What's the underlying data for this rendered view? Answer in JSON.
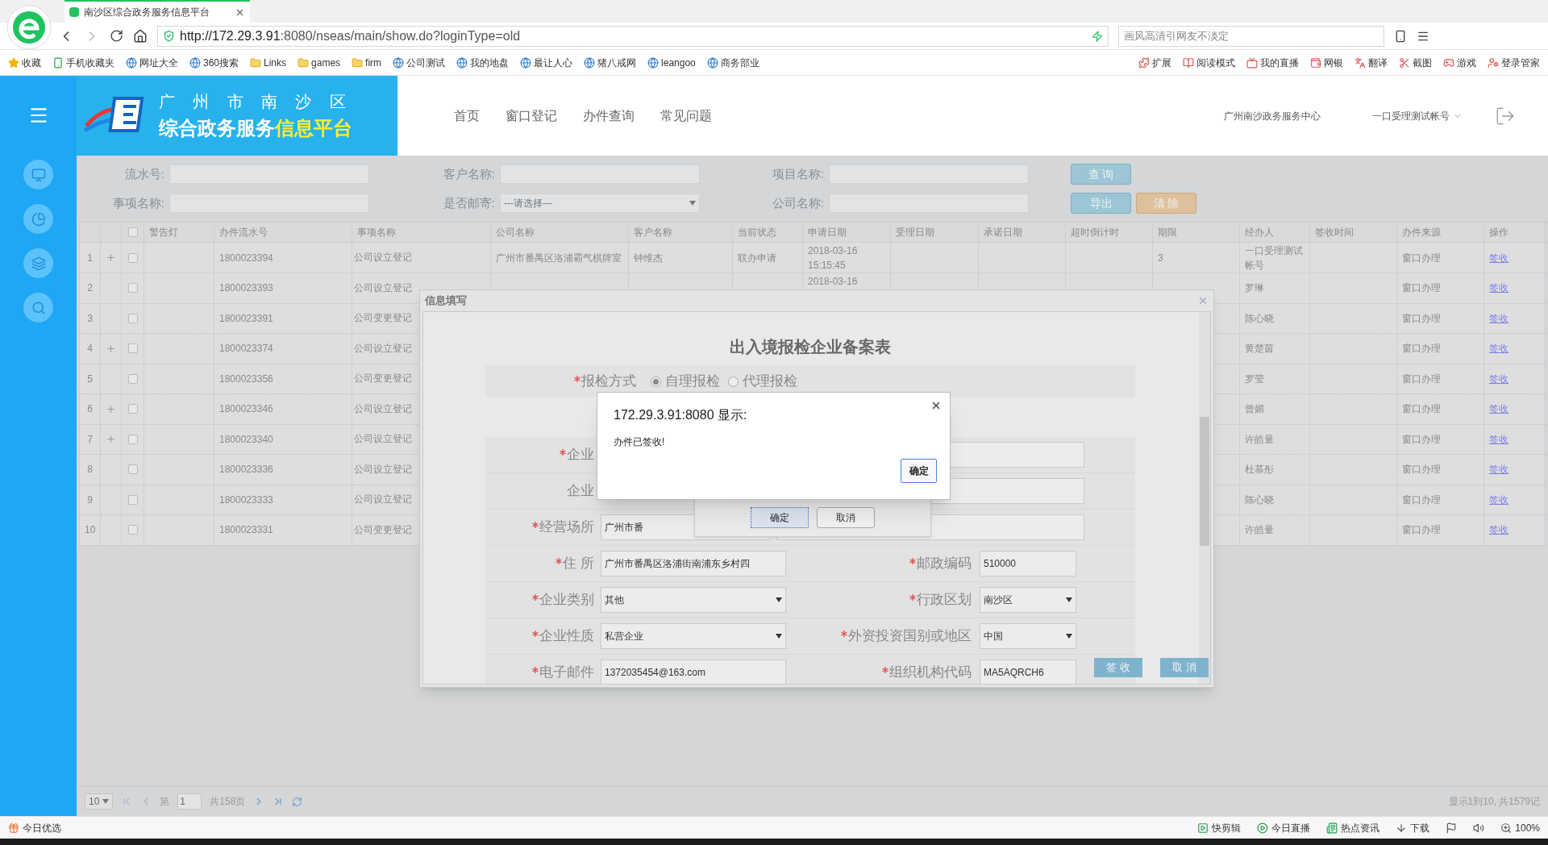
{
  "browser": {
    "tab_title": "南沙区综合政务服务信息平台",
    "url_host": "http://172.29.3.91",
    "url_rest": ":8080/nseas/main/show.do?loginType=old",
    "search_placeholder": "画风高清引网友不淡定",
    "bookmarks": [
      {
        "label": "收藏",
        "kind": "star"
      },
      {
        "label": "手机收藏夹",
        "kind": "phone"
      },
      {
        "label": "网址大全",
        "kind": "site"
      },
      {
        "label": "360搜索",
        "kind": "site"
      },
      {
        "label": "Links",
        "kind": "folder"
      },
      {
        "label": "games",
        "kind": "folder"
      },
      {
        "label": "firm",
        "kind": "folder"
      },
      {
        "label": "公司测试",
        "kind": "site"
      },
      {
        "label": "我的地盘",
        "kind": "site"
      },
      {
        "label": "最让人心",
        "kind": "site"
      },
      {
        "label": "猪八戒网",
        "kind": "site"
      },
      {
        "label": "leangoo",
        "kind": "site"
      },
      {
        "label": "商务部业",
        "kind": "site"
      }
    ],
    "tools": [
      "扩展",
      "阅读模式",
      "我的直播",
      "网银",
      "翻译",
      "截图",
      "游戏",
      "登录管家"
    ]
  },
  "header": {
    "logo_top": "广 州 市 南 沙 区",
    "logo_main": "综合政务服务",
    "logo_highlight": "信息平台",
    "nav": [
      "首页",
      "窗口登记",
      "办件查询",
      "常见问题"
    ],
    "center": "广州南沙政务服务中心",
    "account": "一口受理测试帐号"
  },
  "search": {
    "fields": [
      {
        "label": "流水号:",
        "kind": "input"
      },
      {
        "label": "客户名称:",
        "kind": "input"
      },
      {
        "label": "项目名称:",
        "kind": "input"
      },
      {
        "label": "事项名称:",
        "kind": "input"
      },
      {
        "label": "是否邮寄:",
        "kind": "select",
        "placeholder": "---请选择---"
      },
      {
        "label": "公司名称:",
        "kind": "input"
      }
    ],
    "buttons": [
      {
        "label": "查 询",
        "kind": "blue"
      },
      {
        "label": "导出",
        "kind": "blue"
      },
      {
        "label": "清 除",
        "kind": "orange"
      }
    ]
  },
  "table": {
    "header_checked": false,
    "columns": [
      "警告灯",
      "办件流水号",
      "事项名称",
      "公司名称",
      "客户名称",
      "当前状态",
      "申请日期",
      "受理日期",
      "承诺日期",
      "超时倒计时",
      "期限",
      "经办人",
      "签收时间",
      "办件来源",
      "操作"
    ],
    "rows": [
      {
        "no": "1",
        "expandable": true,
        "checked": false,
        "serial": "1800023394",
        "item": "公司设立登记",
        "company": "广州市番禺区洛浦霸气棋牌室",
        "customer": "钟维杰",
        "status": "联办申请",
        "apply_date": [
          "2018-03-16",
          "15:15:45"
        ],
        "period": "3",
        "handler": "一口受理测试帐号",
        "source": "窗口办理",
        "action": "签收"
      },
      {
        "no": "2",
        "expandable": false,
        "checked": false,
        "serial": "1800023393",
        "item": "公司设立登记",
        "apply_date": [
          "2018-03-16"
        ],
        "handler": "罗琳",
        "source": "窗口办理",
        "action": "签收"
      },
      {
        "no": "3",
        "expandable": false,
        "checked": false,
        "serial": "1800023391",
        "item": "公司变更登记",
        "handler": "陈心晓",
        "source": "窗口办理",
        "action": "签收"
      },
      {
        "no": "4",
        "expandable": true,
        "checked": false,
        "serial": "1800023374",
        "item": "公司设立登记",
        "handler": "黄楚茵",
        "source": "窗口办理",
        "action": "签收"
      },
      {
        "no": "5",
        "expandable": false,
        "checked": false,
        "serial": "1800023356",
        "item": "公司变更登记",
        "handler": "罗莹",
        "source": "窗口办理",
        "action": "签收"
      },
      {
        "no": "6",
        "expandable": true,
        "checked": false,
        "serial": "1800023346",
        "item": "公司设立登记",
        "handler": "曾媚",
        "source": "窗口办理",
        "action": "签收"
      },
      {
        "no": "7",
        "expandable": true,
        "checked": false,
        "serial": "1800023340",
        "item": "公司设立登记",
        "handler": "许皓量",
        "source": "窗口办理",
        "action": "签收"
      },
      {
        "no": "8",
        "expandable": false,
        "checked": false,
        "serial": "1800023336",
        "item": "公司设立登记",
        "handler": "杜慕彤",
        "source": "窗口办理",
        "action": "签收"
      },
      {
        "no": "9",
        "expandable": false,
        "checked": false,
        "serial": "1800023333",
        "item": "公司设立登记",
        "handler": "陈心晓",
        "source": "窗口办理",
        "action": "签收"
      },
      {
        "no": "10",
        "expandable": false,
        "checked": false,
        "serial": "1800023331",
        "item": "公司变更登记",
        "handler": "许皓量",
        "source": "窗口办理",
        "action": "签收"
      }
    ]
  },
  "pager": {
    "page_size": "10",
    "page_label": "第",
    "page": "1",
    "total_pages": "共158页",
    "summary": "显示1到10, 共1579记"
  },
  "dialog": {
    "title": "信息填写",
    "form_title": "出入境报检企业备案表",
    "radio_label": "报检方式",
    "radio_required": true,
    "radios": [
      {
        "label": "自理报检",
        "selected": true
      },
      {
        "label": "代理报检",
        "selected": false
      }
    ],
    "rows": [
      {
        "kind": "wide",
        "left": {
          "label": "企业",
          "required": true
        }
      },
      {
        "kind": "wide",
        "left": {
          "label": "企业",
          "required": false
        }
      },
      {
        "kind": "wide",
        "left": {
          "label": "经营场所",
          "required": true,
          "kind": "input",
          "value": "广州市番"
        }
      },
      {
        "kind": "pair",
        "left": {
          "label": "住 所",
          "required": true,
          "kind": "input",
          "value": "广州市番禺区洛浦街南浦东乡村四"
        },
        "right": {
          "label": "邮政编码",
          "required": true,
          "kind": "input",
          "value": "510000"
        }
      },
      {
        "kind": "pair",
        "left": {
          "label": "企业类别",
          "required": true,
          "kind": "select",
          "value": "其他"
        },
        "right": {
          "label": "行政区划",
          "required": true,
          "kind": "select",
          "value": "南沙区"
        }
      },
      {
        "kind": "pair",
        "left": {
          "label": "企业性质",
          "required": true,
          "kind": "select",
          "value": "私营企业"
        },
        "right": {
          "label": "外资投资国别或地区",
          "required": true,
          "kind": "select",
          "value": "中国"
        }
      },
      {
        "kind": "pair",
        "left": {
          "label": "电子邮件",
          "required": true,
          "kind": "input",
          "value": "1372035454@163.com"
        },
        "right": {
          "label": "组织机构代码",
          "required": true,
          "kind": "input",
          "value": "MA5AQRCH6"
        }
      }
    ],
    "buttons": [
      "签 收",
      "取 消"
    ]
  },
  "confirm": {
    "buttons": [
      "确定",
      "取消"
    ]
  },
  "alert": {
    "title": "172.29.3.91:8080 显示:",
    "message": "办件已签收!",
    "button": "确定"
  },
  "status_bar": {
    "left": "今日优选",
    "items": [
      "快剪辑",
      "今日直播",
      "热点资讯",
      "下载"
    ],
    "zoom": "100%"
  }
}
